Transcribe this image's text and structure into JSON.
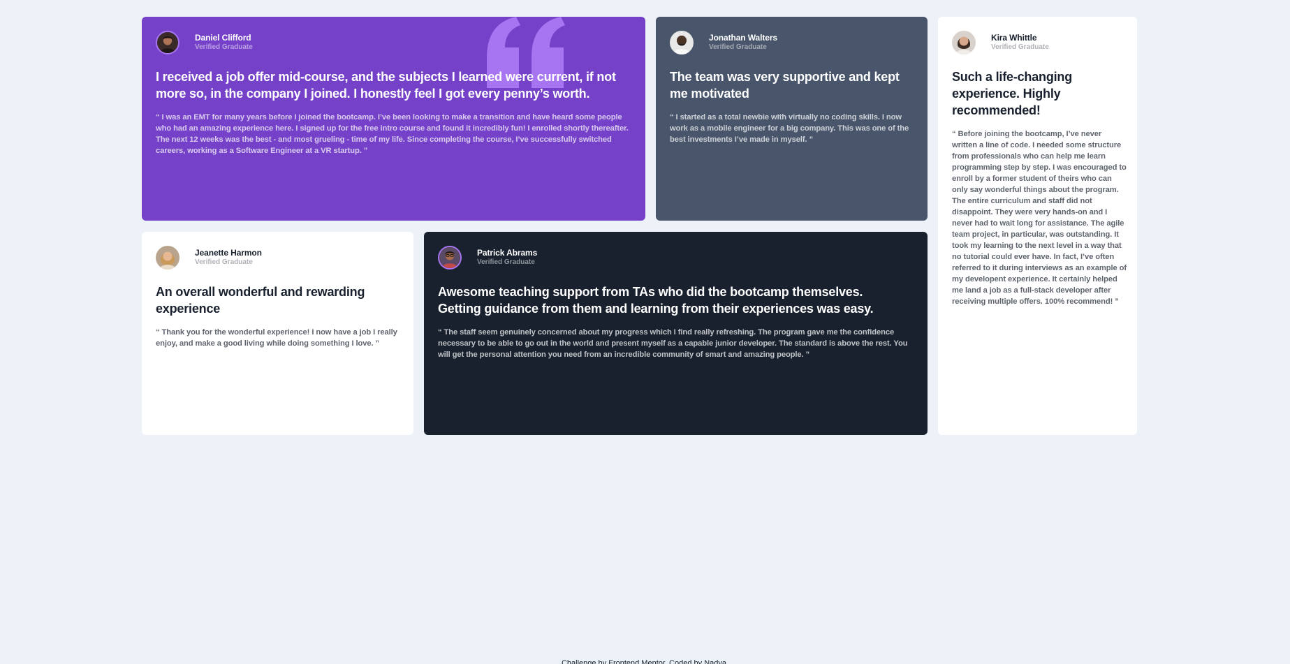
{
  "colors": {
    "page_bg": "#ecf2f8",
    "purple": "#7541c8",
    "purple_quote_mark": "#a775f1",
    "grey": "#48556a",
    "dark": "#19212e",
    "white": "#ffffff"
  },
  "testimonials": [
    {
      "name": "Daniel Clifford",
      "role": "Verified Graduate",
      "headline": "I received a job offer mid-course, and the subjects I learned were current, if not more so, in the company I joined. I honestly feel I got every penny’s worth.",
      "quote": "“ I was an EMT for many years before I joined the bootcamp. I’ve been looking to make a transition and have heard some people who had an amazing experience here. I signed up for the free intro course and found it incredibly fun! I enrolled shortly thereafter. The next 12 weeks was the best - and most grueling - time of my life. Since completing the course, I’ve successfully switched careers, working as a Software Engineer at a VR startup. ”",
      "theme": "purple",
      "avatar_icon": "avatar-daniel-icon"
    },
    {
      "name": "Jonathan Walters",
      "role": "Verified Graduate",
      "headline": "The team was very supportive and kept me motivated",
      "quote": "“ I started as a total newbie with virtually no coding skills. I now work as a mobile engineer for a big company. This was one of the best investments I’ve made in myself. ”",
      "theme": "grey",
      "avatar_icon": "avatar-jonathan-icon"
    },
    {
      "name": "Kira Whittle",
      "role": "Verified Graduate",
      "headline": "Such a life-changing experience. Highly recommended!",
      "quote": "“ Before joining the bootcamp, I’ve never written a line of code. I needed some structure from professionals who can help me learn programming step by step. I was encouraged to enroll by a former student of theirs who can only say wonderful things about the program. The entire curriculum and staff did not disappoint. They were very hands-on and I never had to wait long for assistance. The agile team project, in particular, was outstanding. It took my learning to the next level in a way that no tutorial could ever have. In fact, I’ve often referred to it during interviews as an example of my developent experience. It certainly helped me land a job as a full-stack developer after receiving multiple offers. 100% recommend! ”",
      "theme": "white",
      "avatar_icon": "avatar-kira-icon"
    },
    {
      "name": "Jeanette Harmon",
      "role": "Verified Graduate",
      "headline": "An overall wonderful and rewarding experience",
      "quote": "“ Thank you for the wonderful experience! I now have a job I really enjoy, and make a good living while doing something I love. ”",
      "theme": "white",
      "avatar_icon": "avatar-jeanette-icon"
    },
    {
      "name": "Patrick Abrams",
      "role": "Verified Graduate",
      "headline": "Awesome teaching support from TAs who did the bootcamp themselves. Getting guidance from them and learning from their experiences was easy.",
      "quote": "“ The staff seem genuinely concerned about my progress which I find really refreshing. The program gave me the confidence necessary to be able to go out in the world and present myself as a capable junior developer. The standard is above the rest. You will get the personal attention you need from an incredible community of smart and amazing people. ”",
      "theme": "dark",
      "avatar_icon": "avatar-patrick-icon"
    }
  ],
  "decor": {
    "quote_mark_icon": "quotation-mark-icon"
  },
  "footer": {
    "attribution": "Challenge by Frontend Mentor. Coded by Nadya."
  }
}
